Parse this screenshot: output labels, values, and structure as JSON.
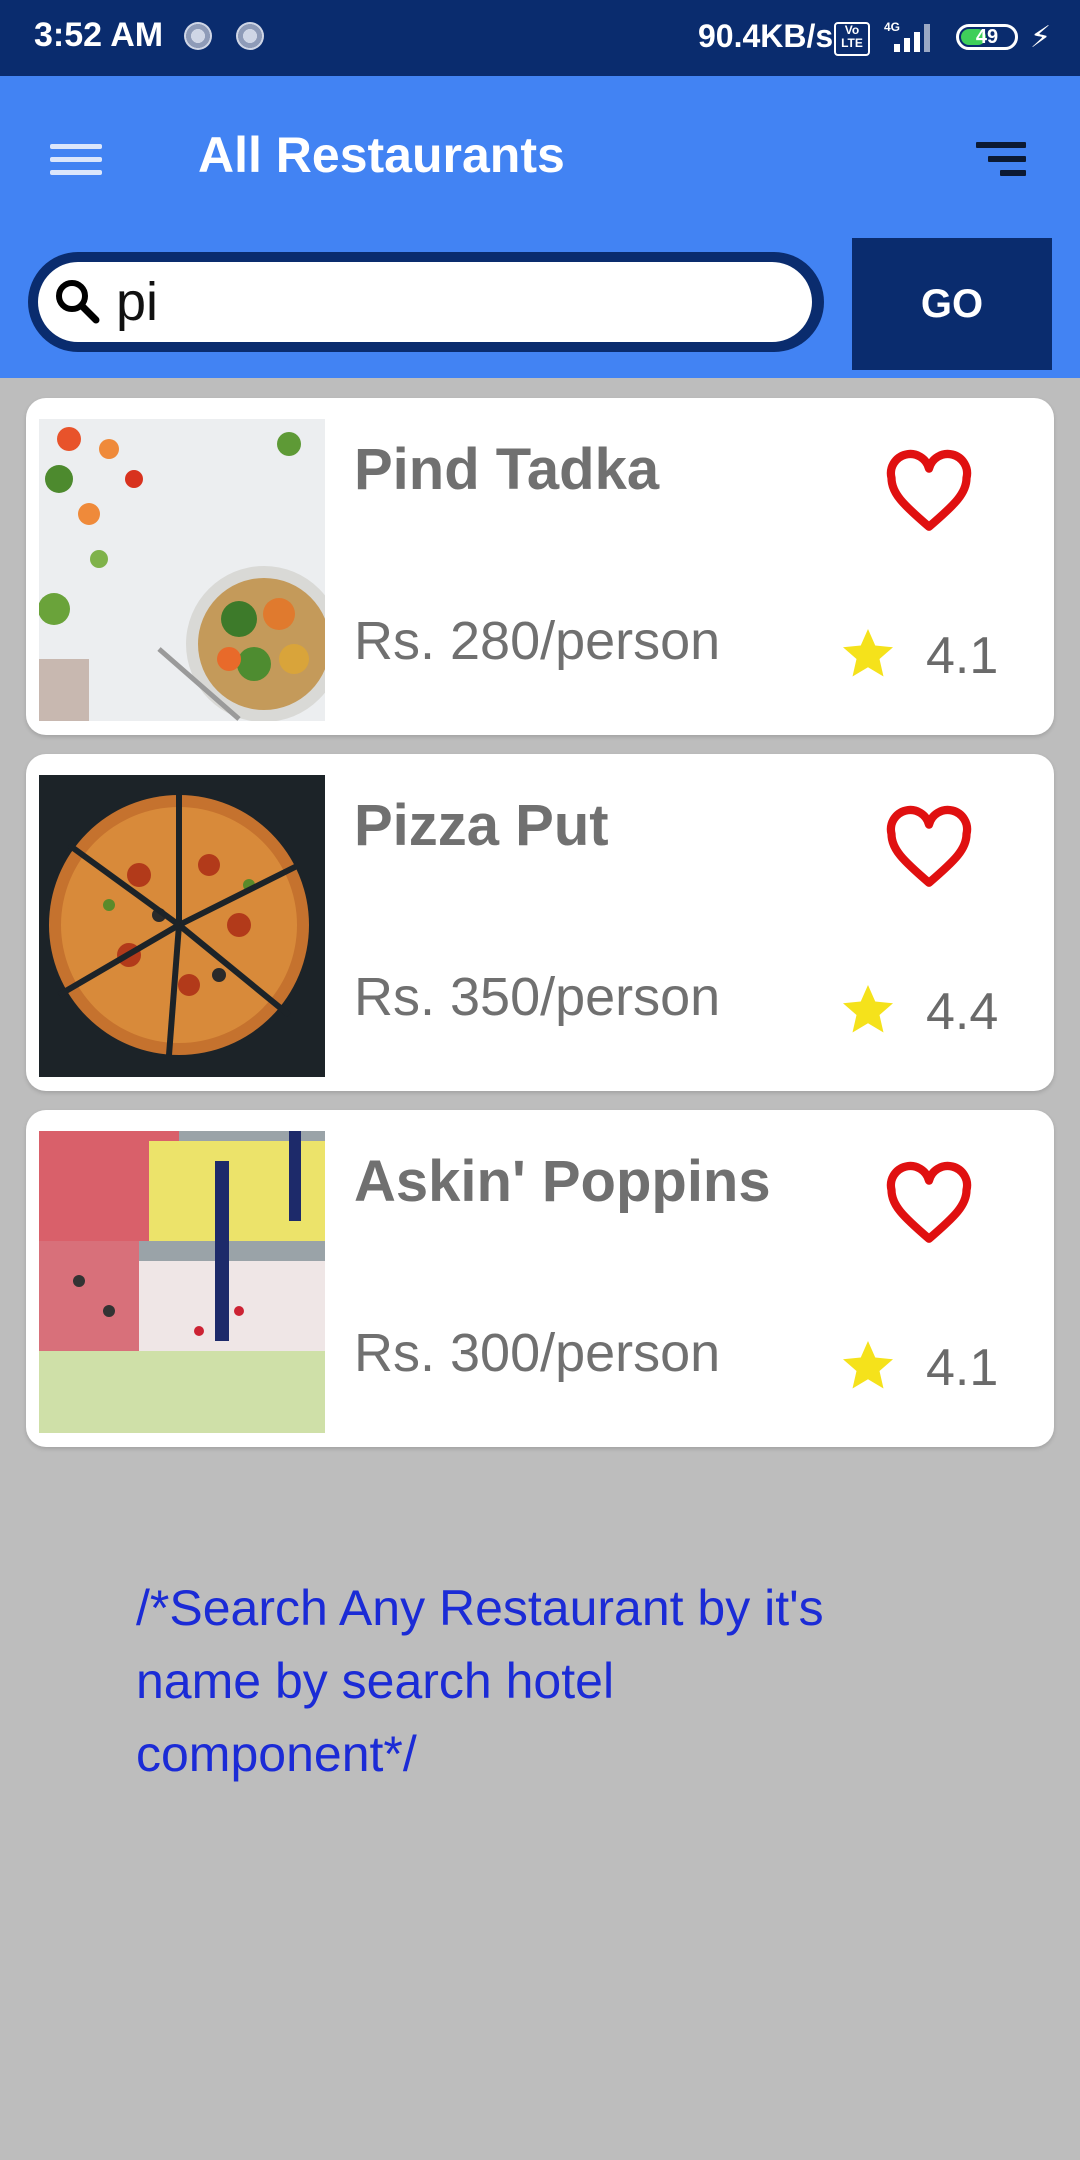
{
  "status_bar": {
    "time": "3:52 AM",
    "network_speed": "90.4KB/s",
    "volte_label": "Vo LTE",
    "network_type": "4G",
    "battery_level": "49",
    "battery_percent": 49
  },
  "app_bar": {
    "title": "All Restaurants",
    "menu_icon": "hamburger-menu-icon",
    "sort_icon": "sort-icon"
  },
  "search": {
    "value": "pi",
    "go_label": "GO"
  },
  "restaurants": [
    {
      "name": "Pind Tadka",
      "price": "Rs. 280/person",
      "rating": "4.1",
      "image": "salad-bowl-photo"
    },
    {
      "name": "Pizza Put",
      "price": "Rs. 350/person",
      "rating": "4.4",
      "image": "pizza-photo"
    },
    {
      "name": "Askin' Poppins",
      "price": "Rs. 300/person",
      "rating": "4.1",
      "image": "ice-cream-photo"
    }
  ],
  "annotation": "/*Search Any Restaurant by it's name by search hotel component*/",
  "colors": {
    "status_bar": "#0a2c6e",
    "app_bar": "#4283f3",
    "go_button": "#0a2c6e",
    "heart": "#e01010",
    "star": "#f5e21b",
    "annotation_text": "#1b2bd6",
    "background": "#bdbdbd"
  }
}
